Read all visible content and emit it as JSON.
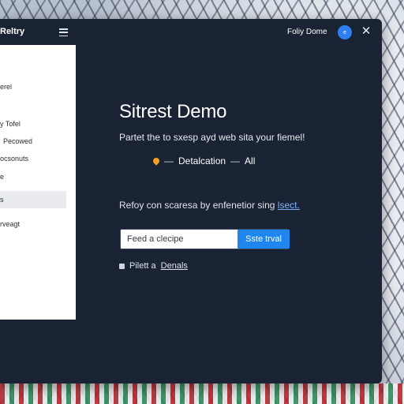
{
  "window": {
    "app_name": "Reltry",
    "user_name": "Foliy Dome",
    "avatar_initial": "e"
  },
  "sidebar": {
    "items": [
      {
        "label": "erel",
        "active": false
      },
      {
        "label": "y Tofel",
        "active": false
      },
      {
        "label": "Pecowed",
        "active": false
      },
      {
        "label": "ocsonuts",
        "active": false
      },
      {
        "label": "e",
        "active": false
      },
      {
        "label": "s",
        "active": true
      },
      {
        "label": "rveagt",
        "active": false
      }
    ]
  },
  "main": {
    "title": "Sitrest Demo",
    "subtitle": "Partet the to sxesp ayd web sita your fiemel!",
    "breadcrumb": {
      "first": "Detalcation",
      "separator": "—",
      "second": "All"
    },
    "helper_text": "Refoy con scaresa by enfenetior sing",
    "helper_link": "lsect.",
    "search": {
      "placeholder": "Feed a clecipe",
      "value": ""
    },
    "search_button_label": "Sste trval",
    "checkbox": {
      "label_prefix": "Pilett a",
      "label_link": "Denals",
      "checked": false
    }
  },
  "colors": {
    "window_bg": "#1a2333",
    "accent": "#1f86f0",
    "pin": "#f3a21d"
  }
}
